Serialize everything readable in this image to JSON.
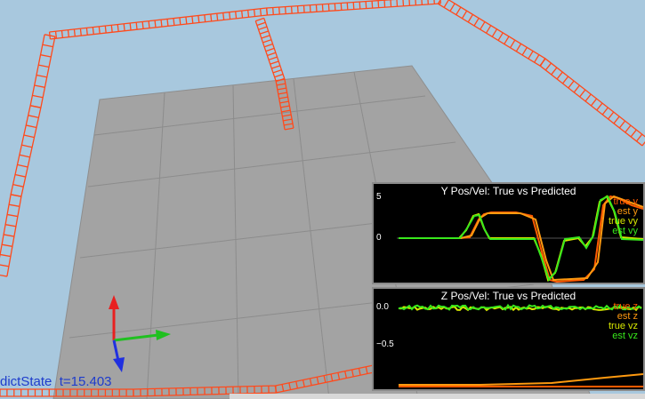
{
  "status": {
    "label": "dictState",
    "time": "t=15.403"
  },
  "colors": {
    "sky": "#a8c8de",
    "ground": "#a3a3a3",
    "path": "#ff4a1c",
    "true_y": "#ff5a00",
    "est_y": "#ff9a10",
    "true_v": "#d8e800",
    "est_v": "#38e81c"
  },
  "plot_y": {
    "title": "Y Pos/Vel: True vs Predicted",
    "ticks": [
      "5",
      "0"
    ],
    "legend": [
      "true y",
      "est y",
      "true vy",
      "est vy"
    ]
  },
  "plot_z": {
    "title": "Z Pos/Vel: True vs Predicted",
    "ticks": [
      "0.0",
      "−0.5"
    ],
    "legend": [
      "true z",
      "est z",
      "true vz",
      "est vz"
    ]
  },
  "axes_gizmo": {
    "icon": "xyz-axes-icon"
  }
}
